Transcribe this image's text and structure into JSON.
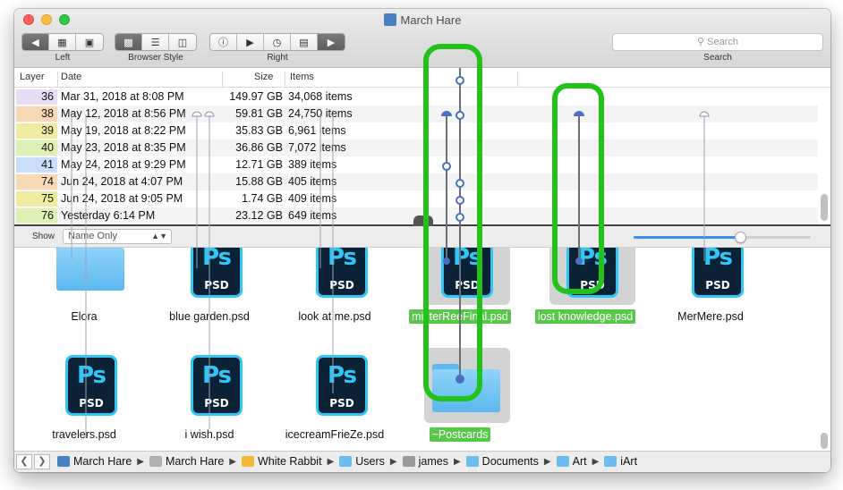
{
  "window": {
    "title": "March Hare"
  },
  "toolbar": {
    "left_label": "Left",
    "browser_style_label": "Browser Style",
    "right_label": "Right",
    "search_placeholder": "Search",
    "search_label": "Search"
  },
  "list": {
    "columns": {
      "layer": "Layer",
      "date": "Date",
      "size": "Size",
      "items": "Items"
    },
    "rows": [
      {
        "layer": "36",
        "date": "Mar 31, 2018 at 8:08 PM",
        "size": "149.97 GB",
        "items": "34,068 items",
        "color": "#e6dcf3"
      },
      {
        "layer": "38",
        "date": "May 12, 2018 at 8:56 PM",
        "size": "59.81 GB",
        "items": "24,750 items",
        "color": "#f9d8b6"
      },
      {
        "layer": "39",
        "date": "May 19, 2018 at 8:22 PM",
        "size": "35.83 GB",
        "items": "6,961 items",
        "color": "#efeba0"
      },
      {
        "layer": "40",
        "date": "May 23, 2018 at 8:35 PM",
        "size": "36.86 GB",
        "items": "7,072 items",
        "color": "#dff0b4"
      },
      {
        "layer": "41",
        "date": "May 24, 2018 at 9:29 PM",
        "size": "12.71 GB",
        "items": "389 items",
        "color": "#c8defa"
      },
      {
        "layer": "74",
        "date": "Jun 24, 2018 at 4:07 PM",
        "size": "15.88 GB",
        "items": "405 items",
        "color": "#f9d8b6"
      },
      {
        "layer": "75",
        "date": "Jun 24, 2018 at 9:05 PM",
        "size": "1.74 GB",
        "items": "409 items",
        "color": "#efeba0"
      },
      {
        "layer": "76",
        "date": "Yesterday 6:14 PM",
        "size": "23.12 GB",
        "items": "649 items",
        "color": "#dff0b4"
      }
    ]
  },
  "showbar": {
    "label": "Show",
    "selected": "Name Only",
    "zoom_fraction": 0.6
  },
  "icons": [
    {
      "name": "Elora",
      "kind": "folder",
      "selected": false
    },
    {
      "name": "blue garden.psd",
      "kind": "psd",
      "selected": false
    },
    {
      "name": "look at me.psd",
      "kind": "psd",
      "selected": false
    },
    {
      "name": "misterReeFinal.psd",
      "kind": "psd",
      "selected": true
    },
    {
      "name": "lost knowledge.psd",
      "kind": "psd",
      "selected": true
    },
    {
      "name": "MerMere.psd",
      "kind": "psd",
      "selected": false
    },
    {
      "name": "travelers.psd",
      "kind": "psd",
      "selected": false
    },
    {
      "name": "i wish.psd",
      "kind": "psd",
      "selected": false
    },
    {
      "name": "icecreamFrieZe.psd",
      "kind": "psd",
      "selected": false
    },
    {
      "name": "~Postcards",
      "kind": "folder",
      "selected": true
    }
  ],
  "icon_texts": {
    "ps": "Ps",
    "psd": "PSD"
  },
  "pathbar": {
    "crumbs": [
      {
        "label": "March Hare",
        "icon": "app-icon",
        "color": "#4b7fc4"
      },
      {
        "label": "March Hare",
        "icon": "drive-icon",
        "color": "#b0b0b0"
      },
      {
        "label": "White Rabbit",
        "icon": "drive-icon",
        "color": "#f3b83a"
      },
      {
        "label": "Users",
        "icon": "folder-icon",
        "color": "#6bbcef"
      },
      {
        "label": "james",
        "icon": "home-icon",
        "color": "#9a9a9a"
      },
      {
        "label": "Documents",
        "icon": "folder-icon",
        "color": "#6bbcef"
      },
      {
        "label": "Art",
        "icon": "folder-icon",
        "color": "#6bbcef"
      },
      {
        "label": "iArt",
        "icon": "folder-icon",
        "color": "#6bbcef"
      }
    ]
  },
  "colors": {
    "highlight_green": "#22c21b",
    "selection_green": "#59c84a",
    "timeline_blue": "#4a6fc0"
  }
}
